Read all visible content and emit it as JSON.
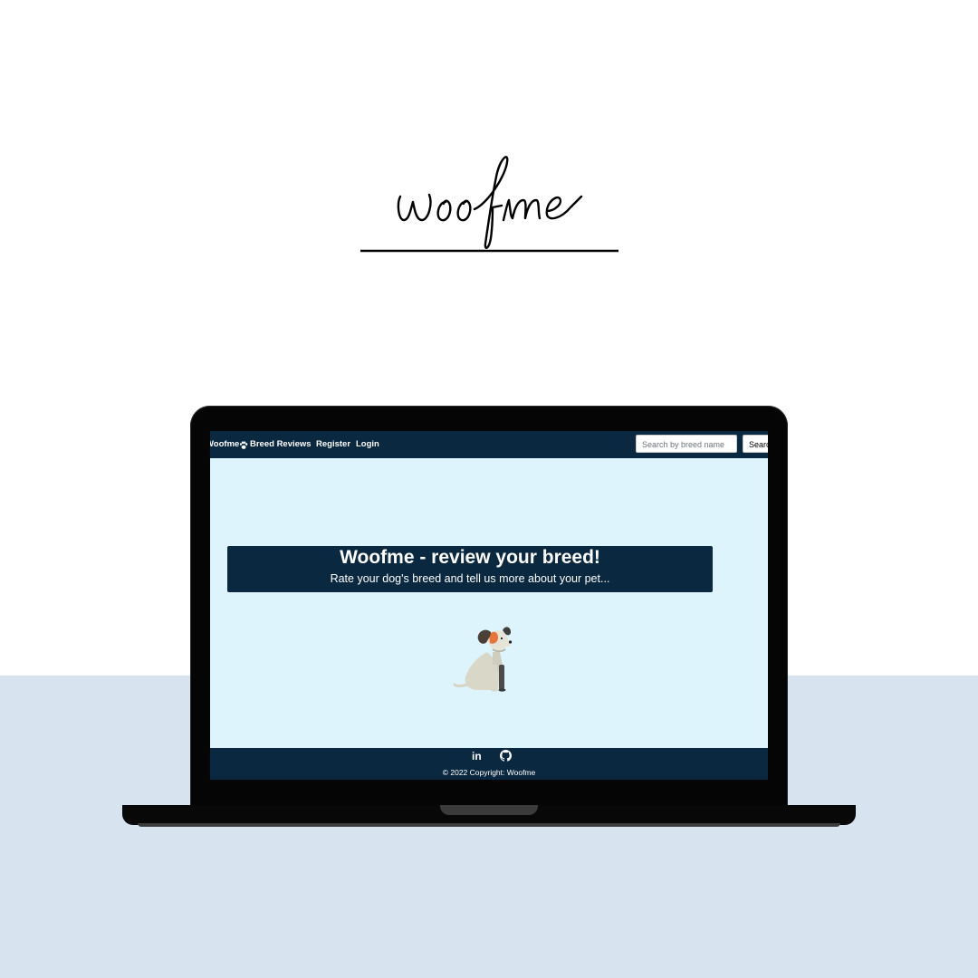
{
  "brand_logo_text": "woofme",
  "site": {
    "nav": {
      "brand": "Woofme",
      "links": [
        "Breed Reviews",
        "Register",
        "Login"
      ],
      "search_placeholder": "Search by breed name",
      "search_button": "Search"
    },
    "hero": {
      "title": "Woofme - review your breed!",
      "subtitle": "Rate your dog's breed and tell us more about your pet..."
    },
    "footer": {
      "social_icons": [
        "linkedin-icon",
        "github-icon"
      ],
      "copyright": "© 2022 Copyright: Woofme"
    }
  },
  "colors": {
    "page_background": "#ffffff",
    "floor": "#d7e4ef",
    "navbar": "#0a2840",
    "site_background": "#ddf4fc",
    "laptop": "#050505"
  }
}
